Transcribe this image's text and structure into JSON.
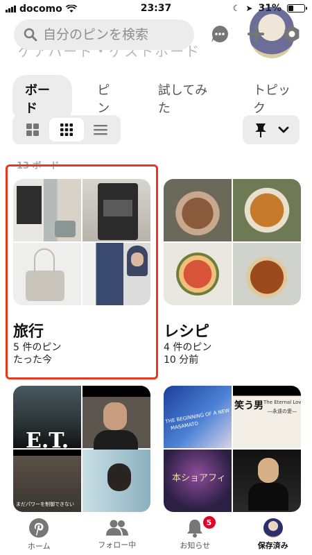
{
  "status": {
    "carrier": "docomo",
    "time": "23:37",
    "battery": "31%",
    "battery_level": 0.31
  },
  "header": {
    "ghost_text": "ゲアハード・ゲストボード",
    "search_placeholder": "自分のピンを検索"
  },
  "tabs": [
    {
      "label": "ボード",
      "active": true
    },
    {
      "label": "ピン",
      "active": false
    },
    {
      "label": "試してみた",
      "active": false
    },
    {
      "label": "トピック",
      "active": false
    }
  ],
  "view_toggle": {
    "selected": "grid"
  },
  "count_label": "13 ボード",
  "boards": [
    {
      "name": "旅行",
      "pins": "5 件のピン",
      "updated": "たった今",
      "colors": [
        "#b8bfbd",
        "#4a4a48",
        "#d6d3cc",
        "#3a4a6e"
      ]
    },
    {
      "name": "レシピ",
      "pins": "4 件のピン",
      "updated": "10 分前",
      "colors": [
        "#8a5a3c",
        "#c57a2c",
        "#d7543a",
        "#9a4a1c"
      ]
    },
    {
      "name": "",
      "pins": "",
      "updated": "",
      "colors": [
        "#3b4952",
        "#1f1d1c",
        "#5a5048",
        "#b9d4dc"
      ]
    },
    {
      "name": "",
      "pins": "",
      "updated": "",
      "colors": [
        "#2a4fa8",
        "#efece6",
        "#3a2f55",
        "#1b1a1a"
      ]
    }
  ],
  "card_texts": {
    "et": "E.T.",
    "warrior": "まだパワーを制御できない",
    "warai": "笑う男",
    "eternal": "The Eternal Love",
    "eien": "―永遠の愛―",
    "beginning": "THE BEGINNING OF A NEW",
    "name_sub": "MASAMATO",
    "mihodori": "本ショアフィ"
  },
  "nav": [
    {
      "label": "ホーム",
      "active": false
    },
    {
      "label": "フォロー中",
      "active": false
    },
    {
      "label": "お知らせ",
      "active": false,
      "badge": "5"
    },
    {
      "label": "保存済み",
      "active": true
    }
  ],
  "colors": {
    "accent_red": "#e60023",
    "highlight": "#e8361f"
  }
}
